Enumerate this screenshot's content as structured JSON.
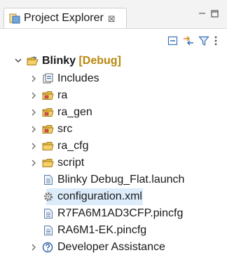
{
  "tab": {
    "title": "Project Explorer",
    "close_glyph": "⊠"
  },
  "toolbar": {
    "icons": [
      "collapse-all-icon",
      "link-with-editor-icon",
      "filter-icon",
      "view-menu-icon"
    ]
  },
  "tree": {
    "project": {
      "name": "Blinky",
      "decoration": "[Debug]",
      "expanded": true
    },
    "items": [
      {
        "label": "Includes",
        "expandable": true,
        "icon": "includes-icon"
      },
      {
        "label": "ra",
        "expandable": true,
        "icon": "source-folder-icon"
      },
      {
        "label": "ra_gen",
        "expandable": true,
        "icon": "source-folder-icon"
      },
      {
        "label": "src",
        "expandable": true,
        "icon": "source-folder-icon"
      },
      {
        "label": "ra_cfg",
        "expandable": true,
        "icon": "folder-icon"
      },
      {
        "label": "script",
        "expandable": true,
        "icon": "folder-icon"
      },
      {
        "label": "Blinky Debug_Flat.launch",
        "expandable": false,
        "icon": "file-icon"
      },
      {
        "label": "configuration.xml",
        "expandable": false,
        "icon": "gear-file-icon",
        "selected": true
      },
      {
        "label": "R7FA6M1AD3CFP.pincfg",
        "expandable": false,
        "icon": "file-icon"
      },
      {
        "label": "RA6M1-EK.pincfg",
        "expandable": false,
        "icon": "file-icon"
      },
      {
        "label": "Developer Assistance",
        "expandable": true,
        "icon": "help-icon"
      }
    ]
  },
  "colors": {
    "selection": "#dcecfb",
    "folder": "#e8b84a",
    "decoration": "#b8860b"
  }
}
